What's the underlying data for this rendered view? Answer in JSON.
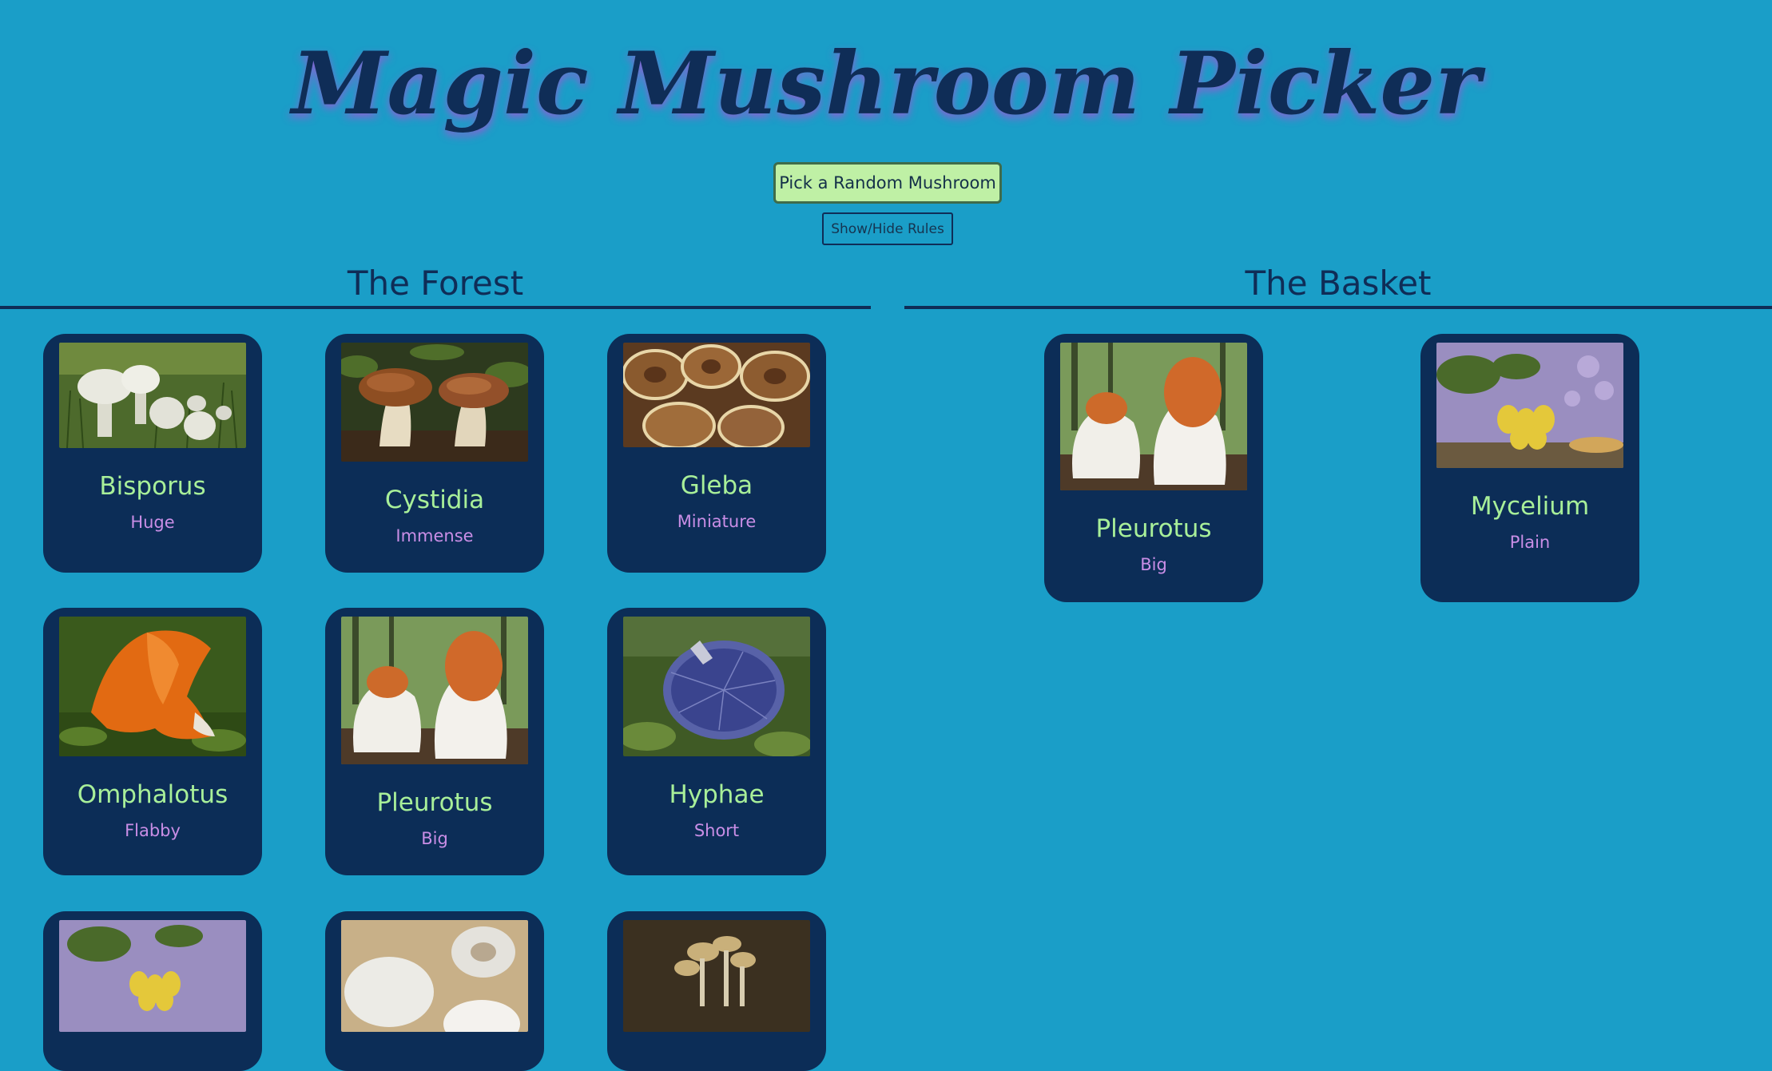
{
  "header": {
    "title": "Magic Mushroom Picker",
    "random_button": "Pick a Random Mushroom",
    "rules_button": "Show/Hide Rules"
  },
  "forest": {
    "title": "The Forest",
    "cards": [
      {
        "name": "Bisporus",
        "size": "Huge"
      },
      {
        "name": "Cystidia",
        "size": "Immense"
      },
      {
        "name": "Gleba",
        "size": "Miniature"
      },
      {
        "name": "Omphalotus",
        "size": "Flabby"
      },
      {
        "name": "Pleurotus",
        "size": "Big"
      },
      {
        "name": "Hyphae",
        "size": "Short"
      },
      {
        "name": "",
        "size": ""
      },
      {
        "name": "",
        "size": ""
      },
      {
        "name": "",
        "size": ""
      }
    ]
  },
  "basket": {
    "title": "The Basket",
    "cards": [
      {
        "name": "Pleurotus",
        "size": "Big"
      },
      {
        "name": "Mycelium",
        "size": "Plain"
      }
    ]
  },
  "colors": {
    "background": "#1a9ec8",
    "card": "#0c2d57",
    "card_name": "#a8ef99",
    "card_size": "#c98ee6",
    "random_button": "#bff0a5",
    "title": "#0f2d57"
  }
}
